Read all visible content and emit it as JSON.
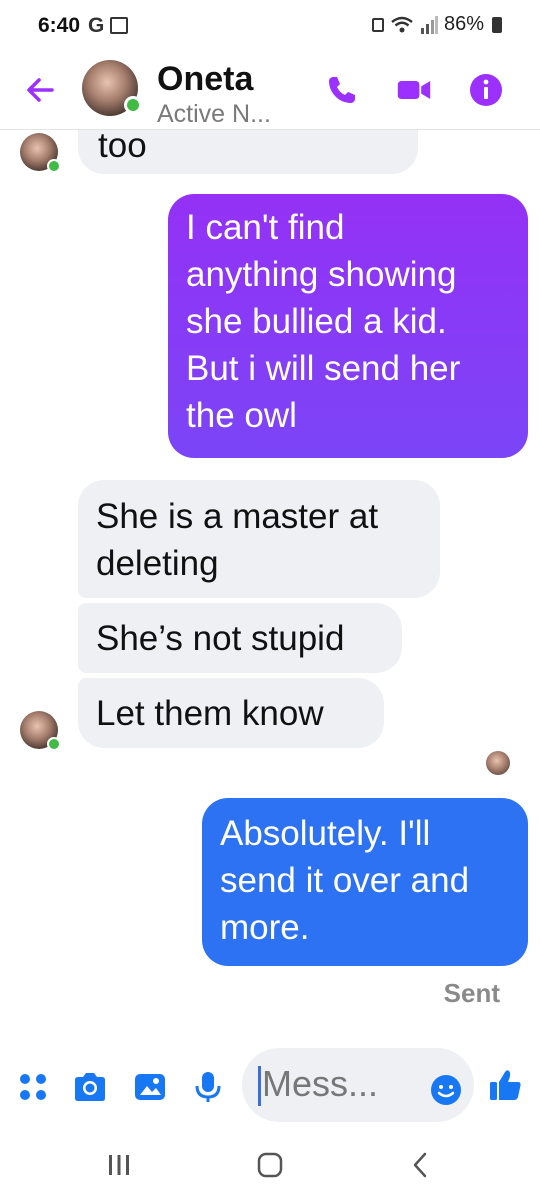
{
  "status_bar": {
    "time": "6:40",
    "carrier_icon": "G",
    "battery": "86%"
  },
  "header": {
    "name": "Oneta",
    "status": "Active N...",
    "accent": "#9b30ff"
  },
  "messages": [
    {
      "dir": "in",
      "text": "too"
    },
    {
      "dir": "out",
      "lines": [
        "I can't find",
        "anything showing",
        "she bullied a kid.",
        "But i will send her",
        "the owl"
      ]
    },
    {
      "dir": "in",
      "lines": [
        "She is a master at",
        "deleting"
      ]
    },
    {
      "dir": "in",
      "text": "She’s not stupid"
    },
    {
      "dir": "in",
      "text": "Let them know"
    },
    {
      "dir": "out",
      "lines": [
        "Absolutely.  I'll",
        "send it over and",
        "more."
      ]
    }
  ],
  "sent_label": "Sent",
  "composer": {
    "placeholder": "Mess...",
    "accent": "#1877f2"
  },
  "colors": {
    "out_purple_top": "#9431f5",
    "out_purple_bottom": "#7b45f7",
    "out_blue": "#2d72f2",
    "in_gray": "#eef0f3"
  }
}
